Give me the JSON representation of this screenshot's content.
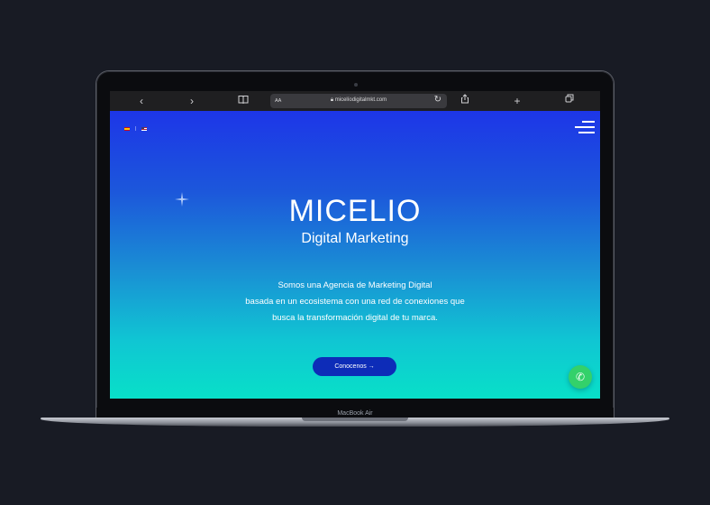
{
  "browser": {
    "back_icon": "‹",
    "forward_icon": "›",
    "bookmarks_icon": "📖",
    "reader_label": "AA",
    "url": "micelíodigitalmkt.com",
    "reload_icon": "↻",
    "share_icon": "⇧",
    "new_tab_icon": "+",
    "tabs_icon": "⧉"
  },
  "site": {
    "lang_separator": "|",
    "title": "MICELIO",
    "subtitle": "Digital Marketing",
    "description_lines": [
      "Somos una Agencia de Marketing Digital",
      "basada  en un ecosistema con una red de conexiones que",
      "busca  la transformación digital de tu marca."
    ],
    "cta_label": "Conocenos →",
    "whatsapp_icon": "✆"
  },
  "device": {
    "label": "MacBook Air"
  },
  "colors": {
    "gradient_top": "#1d36e8",
    "gradient_bottom": "#08e0c8",
    "cta": "#0d2cb8",
    "whatsapp": "#33d16a"
  }
}
